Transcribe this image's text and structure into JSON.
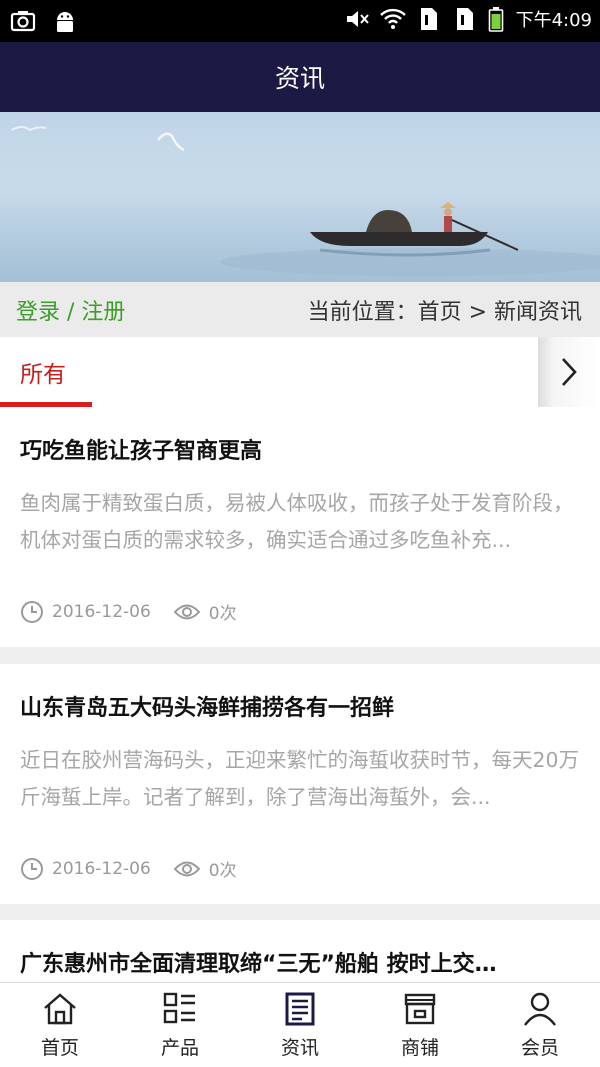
{
  "status_bar": {
    "time": "下午4:09",
    "icons": [
      "camera-icon",
      "android-icon",
      "mute-icon",
      "wifi-icon",
      "sim-1-icon",
      "sim-2-icon",
      "battery-icon"
    ]
  },
  "header": {
    "title": "资讯"
  },
  "breadcrumb": {
    "login_register": "登录 / 注册",
    "location": "当前位置：首页 > 新闻资讯"
  },
  "tabs": {
    "active": "所有",
    "more_icon": "chevron-right-icon"
  },
  "articles": [
    {
      "title": "巧吃鱼能让孩子智商更高",
      "summary": "鱼肉属于精致蛋白质，易被人体吸收，而孩子处于发育阶段，机体对蛋白质的需求较多，确实适合通过多吃鱼补充...",
      "date": "2016-12-06",
      "views": "0次"
    },
    {
      "title": "山东青岛五大码头海鲜捕捞各有一招鲜",
      "summary": "近日在胶州营海码头，正迎来繁忙的海蜇收获时节，每天20万斤海蜇上岸。记者了解到，除了营海出海蜇外，会...",
      "date": "2016-12-06",
      "views": "0次"
    },
    {
      "title": "广东惠州市全面清理取缔“三无”船舶 按时上交…"
    }
  ],
  "bottom_nav": [
    {
      "label": "首页",
      "icon": "home-icon"
    },
    {
      "label": "产品",
      "icon": "grid-list-icon"
    },
    {
      "label": "资讯",
      "icon": "document-icon",
      "active": true
    },
    {
      "label": "商铺",
      "icon": "store-icon"
    },
    {
      "label": "会员",
      "icon": "person-icon"
    }
  ],
  "colors": {
    "header_bg": "#1b1a44",
    "tab_active": "#d81e1e",
    "login_link": "#3b9e28"
  }
}
